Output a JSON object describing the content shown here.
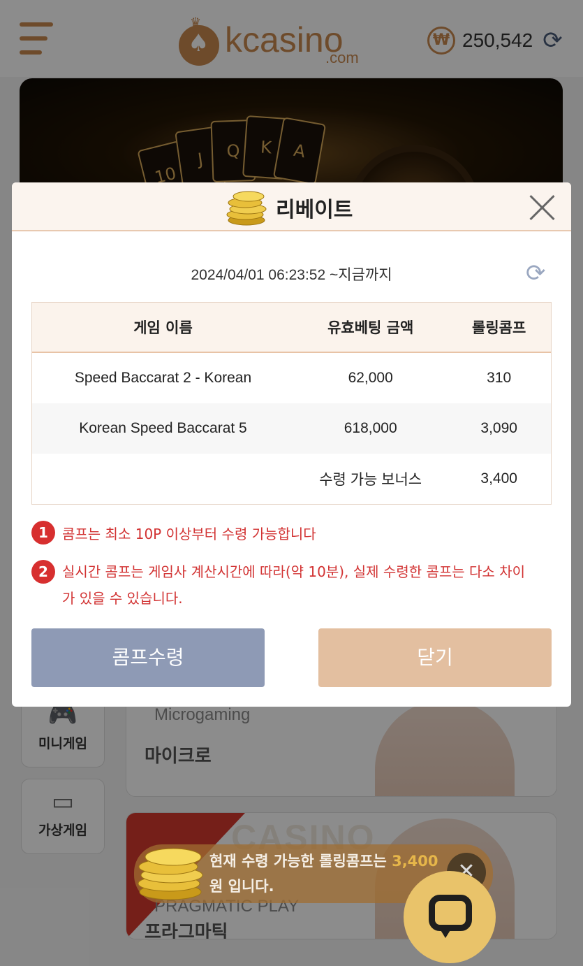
{
  "header": {
    "logo_text": "kcasino",
    "logo_domain": ".com",
    "currency_symbol": "₩",
    "balance": "250,542"
  },
  "sidebar": [
    {
      "label": "미니게임",
      "icon": "gamepad-icon"
    },
    {
      "label": "가상게임",
      "icon": "vr-headset-icon"
    }
  ],
  "game_cards": [
    {
      "provider": "Microgaming",
      "name": "마이크로"
    },
    {
      "provider": "PRAGMATIC PLAY",
      "name": "프라그마틱",
      "brand_word": "CASINO"
    }
  ],
  "modal": {
    "title": "리베이트",
    "period": "2024/04/01 06:23:52 ~지금까지",
    "table": {
      "headers": [
        "게임 이름",
        "유효베팅 금액",
        "롤링콤프"
      ],
      "rows": [
        [
          "Speed Baccarat 2 - Korean",
          "62,000",
          "310"
        ],
        [
          "Korean Speed Baccarat 5",
          "618,000",
          "3,090"
        ]
      ],
      "total_label": "수령 가능 보너스",
      "total_value": "3,400"
    },
    "notes": [
      {
        "num": "1",
        "text": "콤프는 최소 10P 이상부터 수령 가능합니다"
      },
      {
        "num": "2",
        "text": "실시간 콤프는 게임사 계산시간에 따라(약 10분), 실제 수령한 콤프는 다소 차이가 있을 수 있습니다."
      }
    ],
    "claim_button": "콤프수령",
    "close_button": "닫기"
  },
  "toast": {
    "prefix": "현재 수령 가능한 롤링콤프는 ",
    "amount": "3,400",
    "suffix": "원 입니다."
  },
  "colors": {
    "brand": "#c9894f",
    "claim_button": "#8e9ab5",
    "close_button": "#e3bfa0",
    "notice_red": "#d23333",
    "chat_fab": "#e9c36a"
  }
}
